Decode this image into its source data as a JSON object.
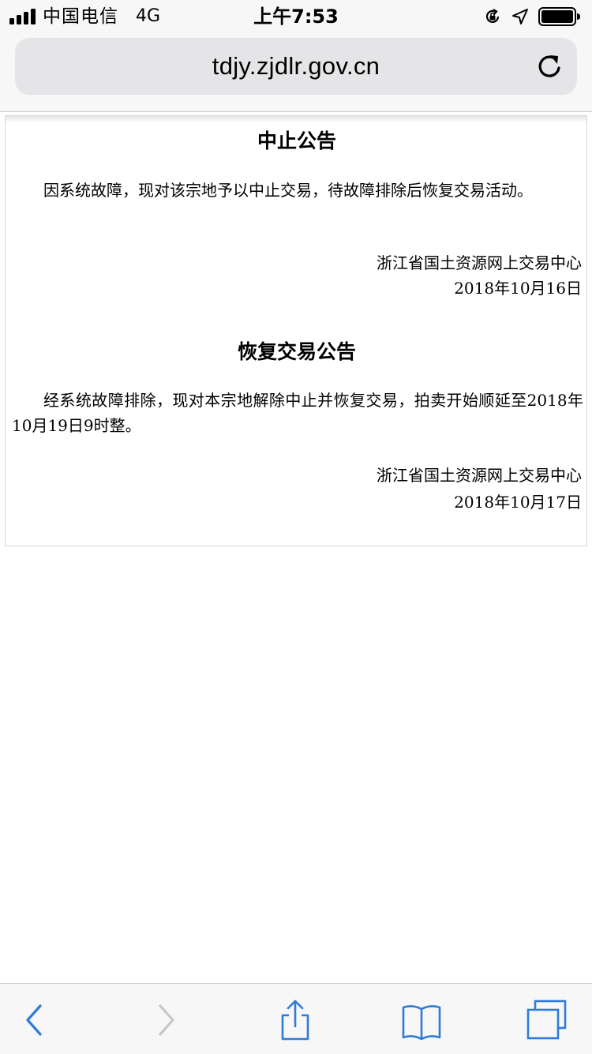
{
  "status_bar": {
    "carrier": "中国电信",
    "network": "4G",
    "time": "上午7:53"
  },
  "browser": {
    "url": "tdjy.zjdlr.gov.cn",
    "accent_color": "#2f7bd8"
  },
  "notices": [
    {
      "title": "中止公告",
      "body": "因系统故障，现对该宗地予以中止交易，待故障排除后恢复交易活动。",
      "signer": "浙江省国土资源网上交易中心",
      "date": "2018年10月16日"
    },
    {
      "title": "恢复交易公告",
      "body": "经系统故障排除，现对本宗地解除中止并恢复交易，拍卖开始顺延至2018年10月19日9时整。",
      "signer": "浙江省国土资源网上交易中心",
      "date": "2018年10月17日"
    }
  ],
  "toolbar": {
    "icons": [
      "back-icon",
      "forward-icon",
      "share-icon",
      "bookmarks-icon",
      "tabs-icon"
    ]
  }
}
